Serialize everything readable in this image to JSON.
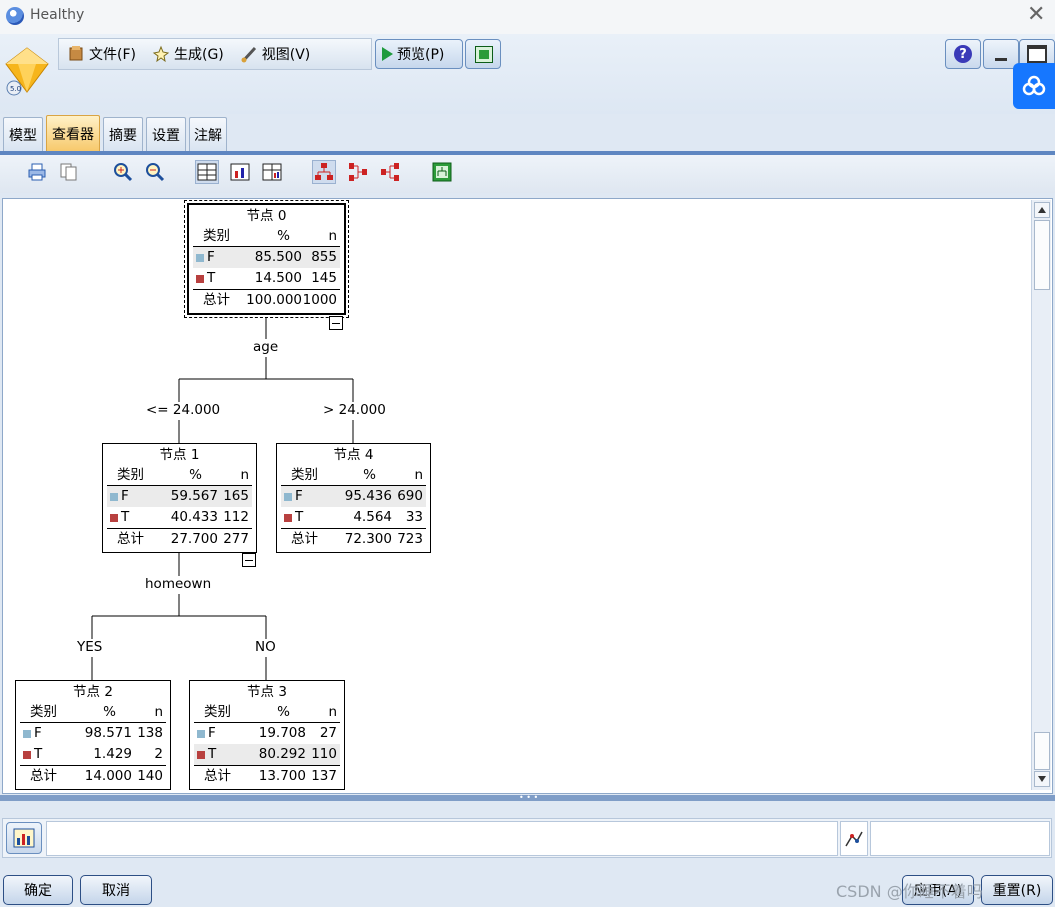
{
  "window": {
    "title": "Healthy",
    "close_glyph": "✕"
  },
  "menu": {
    "file": "文件(F)",
    "generate": "生成(G)",
    "view": "视图(V)",
    "preview": "预览(P)"
  },
  "tabs": [
    "模型",
    "查看器",
    "摘要",
    "设置",
    "注解"
  ],
  "active_tab": "查看器",
  "tree": {
    "header": {
      "category": "类别",
      "percent": "%",
      "n": "n"
    },
    "total_label": "总计",
    "nodes": [
      {
        "title": "节点 0",
        "rows": [
          {
            "cat": "F",
            "pct": "85.500",
            "n": "855"
          },
          {
            "cat": "T",
            "pct": "14.500",
            "n": "145"
          }
        ],
        "total_pct": "100.000",
        "total_n": "1000"
      },
      {
        "title": "节点 1",
        "rows": [
          {
            "cat": "F",
            "pct": "59.567",
            "n": "165"
          },
          {
            "cat": "T",
            "pct": "40.433",
            "n": "112"
          }
        ],
        "total_pct": "27.700",
        "total_n": "277"
      },
      {
        "title": "节点 4",
        "rows": [
          {
            "cat": "F",
            "pct": "95.436",
            "n": "690"
          },
          {
            "cat": "T",
            "pct": "4.564",
            "n": "33"
          }
        ],
        "total_pct": "72.300",
        "total_n": "723"
      },
      {
        "title": "节点 2",
        "rows": [
          {
            "cat": "F",
            "pct": "98.571",
            "n": "138"
          },
          {
            "cat": "T",
            "pct": "1.429",
            "n": "2"
          }
        ],
        "total_pct": "14.000",
        "total_n": "140"
      },
      {
        "title": "节点 3",
        "rows": [
          {
            "cat": "F",
            "pct": "19.708",
            "n": "27"
          },
          {
            "cat": "T",
            "pct": "80.292",
            "n": "110"
          }
        ],
        "total_pct": "13.700",
        "total_n": "137"
      }
    ],
    "splits": {
      "root_var": "age",
      "root_left": "<= 24.000",
      "root_right": "> 24.000",
      "n1_var": "homeown",
      "n1_left": "YES",
      "n1_right": "NO"
    },
    "colors": {
      "F": "#8fb8cf",
      "T": "#b8403f"
    }
  },
  "footer": {
    "ok": "确定",
    "cancel": "取消",
    "apply": "应用(A)",
    "reset": "重置(R)",
    "watermark": "CSDN @你睡不着吗"
  }
}
